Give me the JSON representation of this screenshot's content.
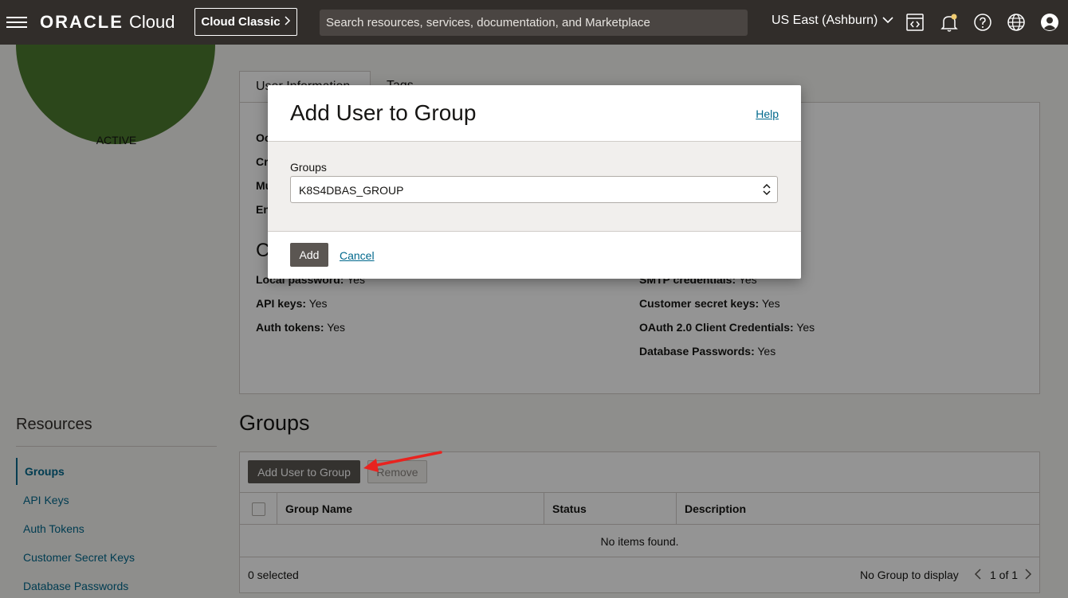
{
  "header": {
    "logo_brand": "ORACLE",
    "logo_product": "Cloud",
    "classic_label": "Cloud Classic",
    "search_placeholder": "Search resources, services, documentation, and Marketplace",
    "region": "US East (Ashburn)",
    "icons": [
      "menu-icon",
      "code-editor-icon",
      "bell-icon",
      "help-icon",
      "globe-icon",
      "profile-icon"
    ]
  },
  "user": {
    "status": "ACTIVE"
  },
  "tabs": [
    {
      "label": "User Information"
    },
    {
      "label": "Tags"
    }
  ],
  "info_panel": {
    "partial_labels": [
      "Oc",
      "Cr",
      "Mu",
      "En"
    ],
    "capabilities_heading_partial": "C",
    "left": [
      {
        "label": "Local password:",
        "value": "Yes"
      },
      {
        "label": "API keys:",
        "value": "Yes"
      },
      {
        "label": "Auth tokens:",
        "value": "Yes"
      }
    ],
    "right": [
      {
        "label": "SMTP credentials:",
        "value": "Yes"
      },
      {
        "label": "Customer secret keys:",
        "value": "Yes"
      },
      {
        "label": "OAuth 2.0 Client Credentials:",
        "value": "Yes"
      },
      {
        "label": "Database Passwords:",
        "value": "Yes"
      }
    ]
  },
  "resources": {
    "title": "Resources",
    "items": [
      {
        "label": "Groups",
        "selected": true
      },
      {
        "label": "API Keys"
      },
      {
        "label": "Auth Tokens"
      },
      {
        "label": "Customer Secret Keys"
      },
      {
        "label": "Database Passwords"
      }
    ]
  },
  "groups": {
    "heading": "Groups",
    "add_button": "Add User to Group",
    "remove_button": "Remove",
    "columns": [
      "Group Name",
      "Status",
      "Description"
    ],
    "empty_message": "No items found.",
    "selected_count": "0 selected",
    "display_text": "No Group to display",
    "pagination": "1 of 1"
  },
  "dialog": {
    "title": "Add User to Group",
    "help": "Help",
    "field_label": "Groups",
    "selected_value": "K8S4DBAS_GROUP",
    "add_label": "Add",
    "cancel_label": "Cancel"
  },
  "colors": {
    "header_bg": "#312d2a",
    "link": "#00688c",
    "button_dark": "#5b5652",
    "status_green": "#4d7a2f",
    "arrow": "#e8231f"
  }
}
